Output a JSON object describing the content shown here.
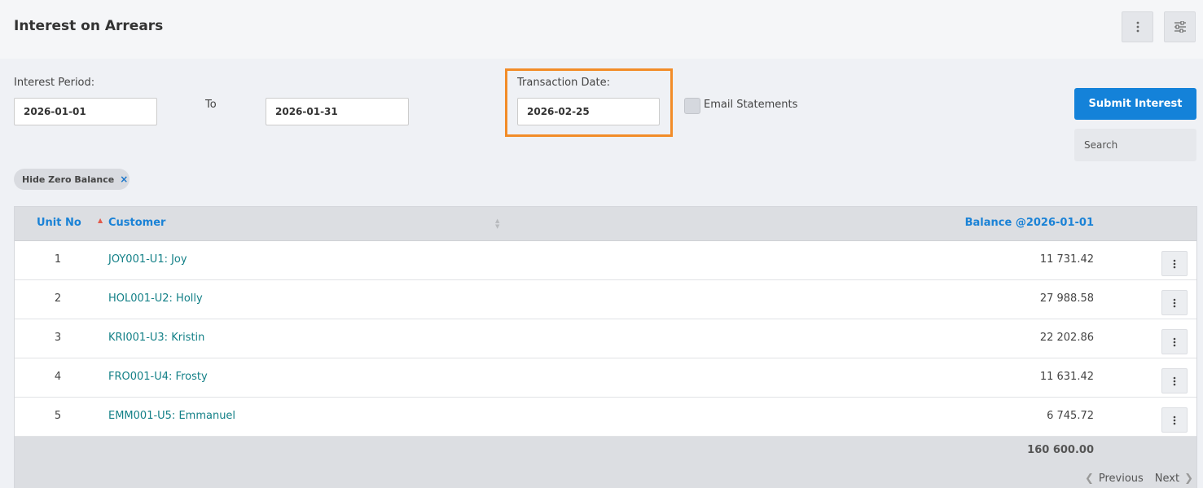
{
  "header": {
    "title": "Interest on Arrears",
    "more_icon": "more-vertical-icon",
    "settings_icon": "sliders-icon"
  },
  "form": {
    "interest_period_label": "Interest Period:",
    "from_date": "2026-01-01",
    "to_label": "To",
    "to_date": "2026-01-31",
    "transaction_date_label": "Transaction Date:",
    "transaction_date": "2026-02-25",
    "email_statements_label": "Email Statements",
    "email_statements_checked": false,
    "submit_label": "Submit Interest",
    "search_placeholder": "Search"
  },
  "filter_chip": {
    "label": "Hide Zero Balance",
    "remove": "×"
  },
  "table": {
    "columns": {
      "unit": "Unit No",
      "customer": "Customer",
      "balance": "Balance @2026-01-01"
    },
    "rows": [
      {
        "unit": "1",
        "customer": "JOY001-U1: Joy",
        "balance": "11 731.42"
      },
      {
        "unit": "2",
        "customer": "HOL001-U2: Holly",
        "balance": "27 988.58"
      },
      {
        "unit": "3",
        "customer": "KRI001-U3: Kristin",
        "balance": "22 202.86"
      },
      {
        "unit": "4",
        "customer": "FRO001-U4: Frosty",
        "balance": "11 631.42"
      },
      {
        "unit": "5",
        "customer": "EMM001-U5: Emmanuel",
        "balance": "6 745.72"
      }
    ],
    "total": "160 600.00"
  },
  "pager": {
    "previous": "Previous",
    "next": "Next"
  },
  "colors": {
    "accent": "#1482d9",
    "link": "#138087",
    "highlight": "#f28c28"
  }
}
